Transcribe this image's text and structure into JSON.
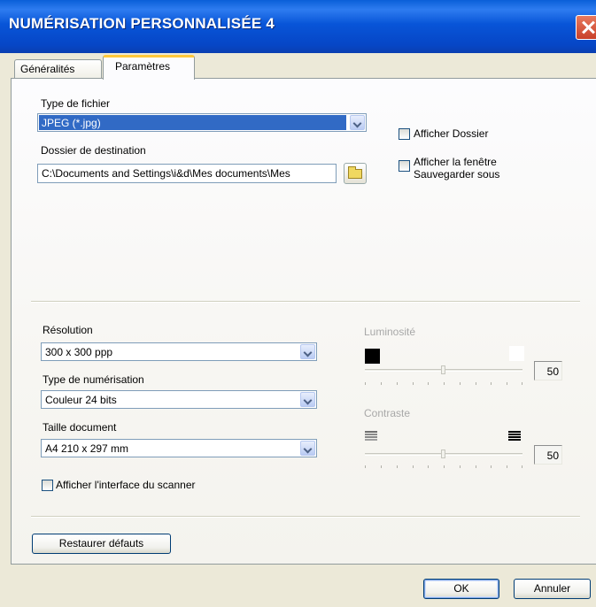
{
  "window": {
    "title": "NUMÉRISATION PERSONNALISÉE 4"
  },
  "tabs": [
    {
      "label": "Généralités",
      "active": false
    },
    {
      "label": "Paramètres",
      "active": true
    }
  ],
  "file": {
    "type_label": "Type de fichier",
    "type_value": "JPEG (*.jpg)",
    "dest_label": "Dossier de destination",
    "dest_value": "C:\\Documents and Settings\\i&d\\Mes documents\\Mes",
    "show_folder_label": "Afficher Dossier",
    "show_folder_checked": false,
    "show_saveas_label_line1": "Afficher la fenêtre",
    "show_saveas_label_line2": "Sauvegarder sous",
    "show_saveas_checked": false
  },
  "scan": {
    "resolution_label": "Résolution",
    "resolution_value": "300 x 300 ppp",
    "scan_type_label": "Type de numérisation",
    "scan_type_value": "Couleur 24 bits",
    "doc_size_label": "Taille document",
    "doc_size_value": "A4 210 x 297 mm",
    "show_scanner_ui_label": "Afficher l'interface du scanner",
    "show_scanner_ui_checked": false
  },
  "brightness": {
    "label": "Luminosité",
    "value": "50",
    "enabled": false
  },
  "contrast": {
    "label": "Contraste",
    "value": "50",
    "enabled": false
  },
  "buttons": {
    "restore_defaults": "Restaurer défauts",
    "ok": "OK",
    "cancel": "Annuler"
  },
  "colors": {
    "title_bar": "#0855D8",
    "tab_highlight": "#FFC83C",
    "selection": "#316AC5",
    "dialog_bg": "#ECE9D8"
  }
}
